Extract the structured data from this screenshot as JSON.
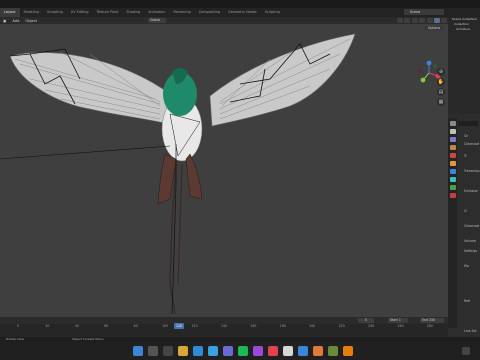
{
  "workspace_tabs": [
    "Layout",
    "Modeling",
    "Sculpting",
    "UV Editing",
    "Texture Paint",
    "Shading",
    "Animation",
    "Rendering",
    "Compositing",
    "Geometry Nodes",
    "Scripting"
  ],
  "active_tab": "Layout",
  "scene_name": "Scene",
  "viewport_menu": {
    "add": "Add",
    "object": "Object"
  },
  "transform_orientation": "Global",
  "options_label": "Options",
  "outliner_items": [
    "Scene Collection",
    "Collection",
    "Armature"
  ],
  "properties": {
    "rows": [
      "Ch",
      "Clearcoat",
      "Tr",
      "Transmission",
      "Emission",
      "Cl",
      "Clearcoat",
      "Volume",
      "Settings",
      "Ma",
      "Refr",
      "Line Art"
    ]
  },
  "timeline": {
    "current_frame": "120",
    "frame_value": "0",
    "start_label": "Start",
    "start_value": "1",
    "end_label": "End",
    "end_value": "250",
    "ruler_ticks": [
      "0",
      "20",
      "40",
      "60",
      "80",
      "100",
      "120",
      "140",
      "160",
      "180",
      "200",
      "220",
      "240",
      "260",
      "280"
    ]
  },
  "status_bar": {
    "left": "Rotate View",
    "middle": "Object Context Menu"
  },
  "colors": {
    "viewport_bg": "#3f3f3f",
    "accent": "#4772b3",
    "gizmo_x": "#e0424f",
    "gizmo_y": "#8bc43f",
    "gizmo_z": "#3d85d6",
    "bird_head": "#1e8a6a",
    "bird_body": "#e8e8e8"
  }
}
